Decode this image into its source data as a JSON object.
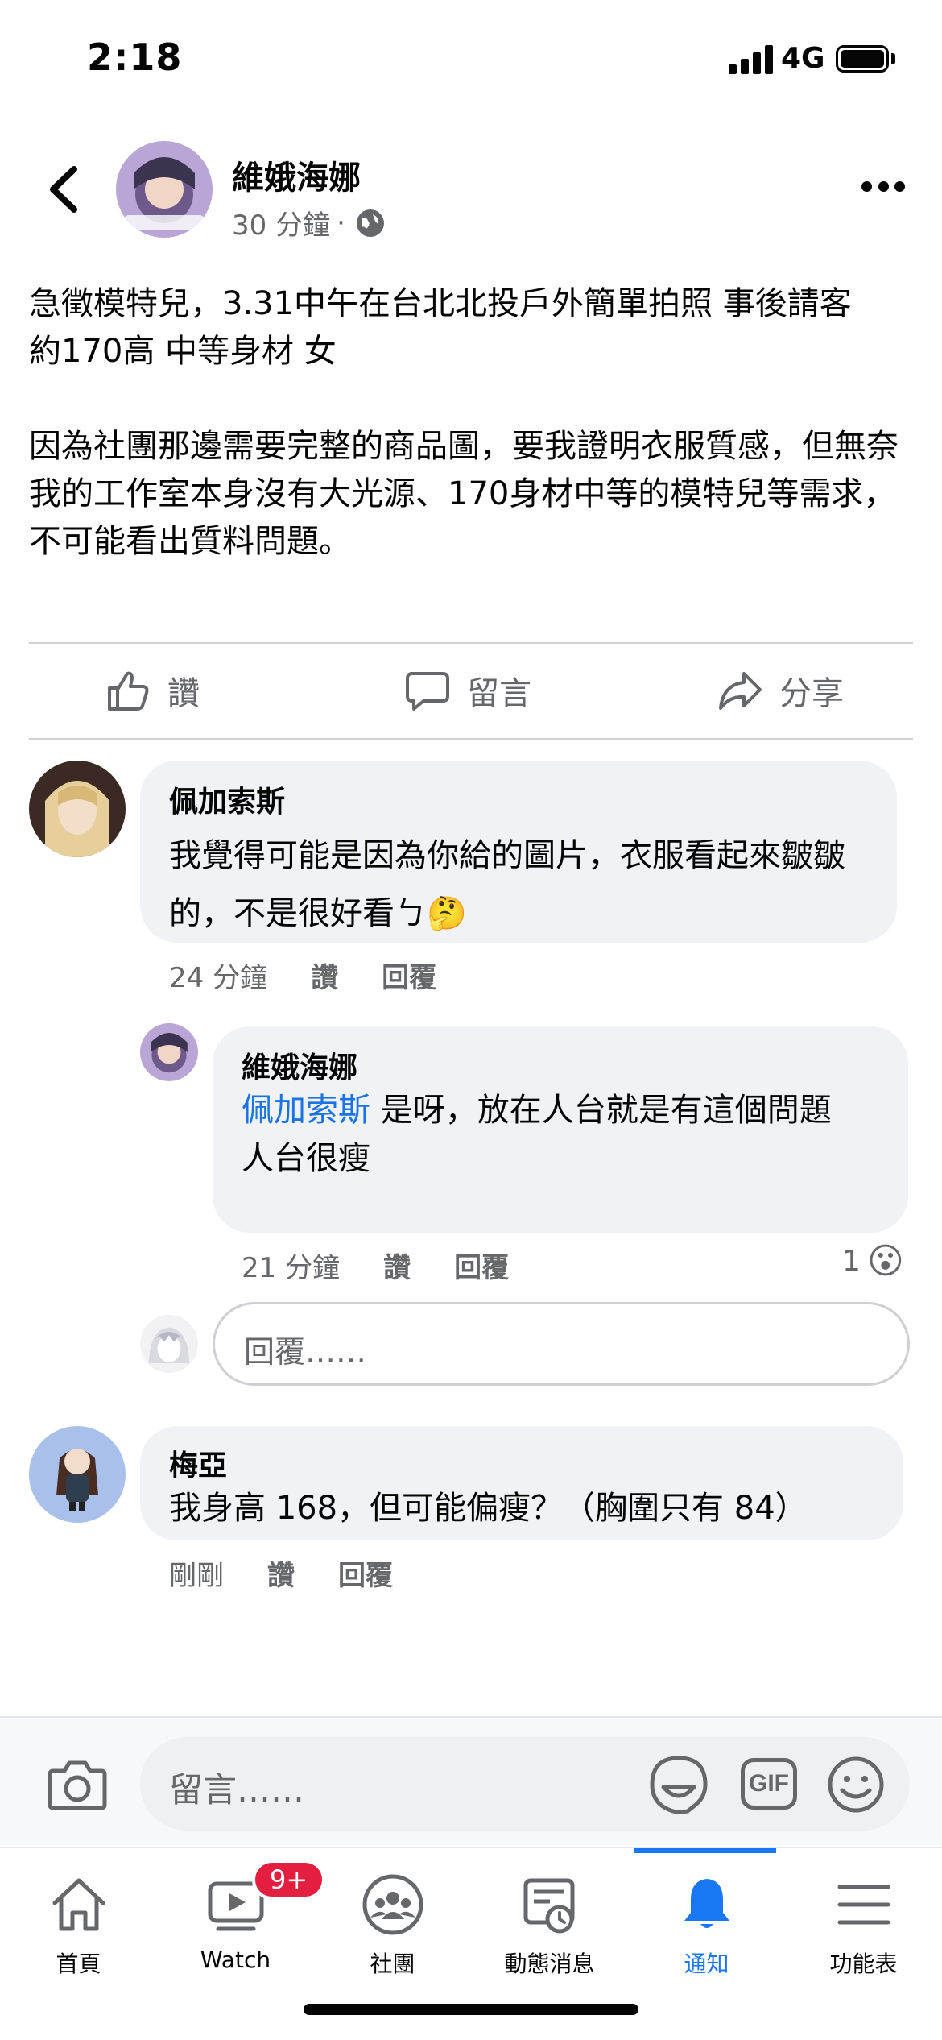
{
  "status": {
    "time": "2:18",
    "network": "4G"
  },
  "post": {
    "author": "維娥海娜",
    "time": "30 分鐘",
    "separator": "·",
    "body": "急徵模特兒，3.31中午在台北北投戶外簡單拍照 事後請客\n約170高 中等身材 女\n\n因為社團那邊需要完整的商品圖，要我證明衣服質感，但無奈我的工作室本身沒有大光源、170身材中等的模特兒等需求，不可能看出質料問題。"
  },
  "actions": {
    "like": "讚",
    "comment": "留言",
    "share": "分享"
  },
  "comments": [
    {
      "name": "佩加索斯",
      "text": "我覺得可能是因為你給的圖片，衣服看起來皺皺的，不是很好看ㄅ🤔",
      "time": "24 分鐘",
      "like": "讚",
      "reply": "回覆"
    },
    {
      "name": "維娥海娜",
      "mention": "佩加索斯",
      "text": " 是呀，放在人台就是有這個問題\n人台很瘦",
      "time": "21 分鐘",
      "like": "讚",
      "reply": "回覆",
      "reaction_count": "1",
      "reaction_emoji": "😮"
    },
    {
      "name": "梅亞",
      "text": "我身高 168，但可能偏瘦？（胸圍只有 84）",
      "time": "剛剛",
      "like": "讚",
      "reply": "回覆"
    }
  ],
  "reply_input": {
    "placeholder": "回覆……"
  },
  "compose": {
    "placeholder": "留言……",
    "gif": "GIF"
  },
  "tabs": [
    {
      "label": "首頁",
      "icon": "home-icon"
    },
    {
      "label": "Watch",
      "icon": "watch-icon",
      "badge": "9+"
    },
    {
      "label": "社團",
      "icon": "groups-icon"
    },
    {
      "label": "動態消息",
      "icon": "feed-icon"
    },
    {
      "label": "通知",
      "icon": "bell-icon",
      "active": true
    },
    {
      "label": "功能表",
      "icon": "menu-icon"
    }
  ],
  "colors": {
    "accent": "#1877f2",
    "bubble": "#f0f2f5",
    "secondary_text": "#65676b",
    "badge": "#e41e3f"
  }
}
